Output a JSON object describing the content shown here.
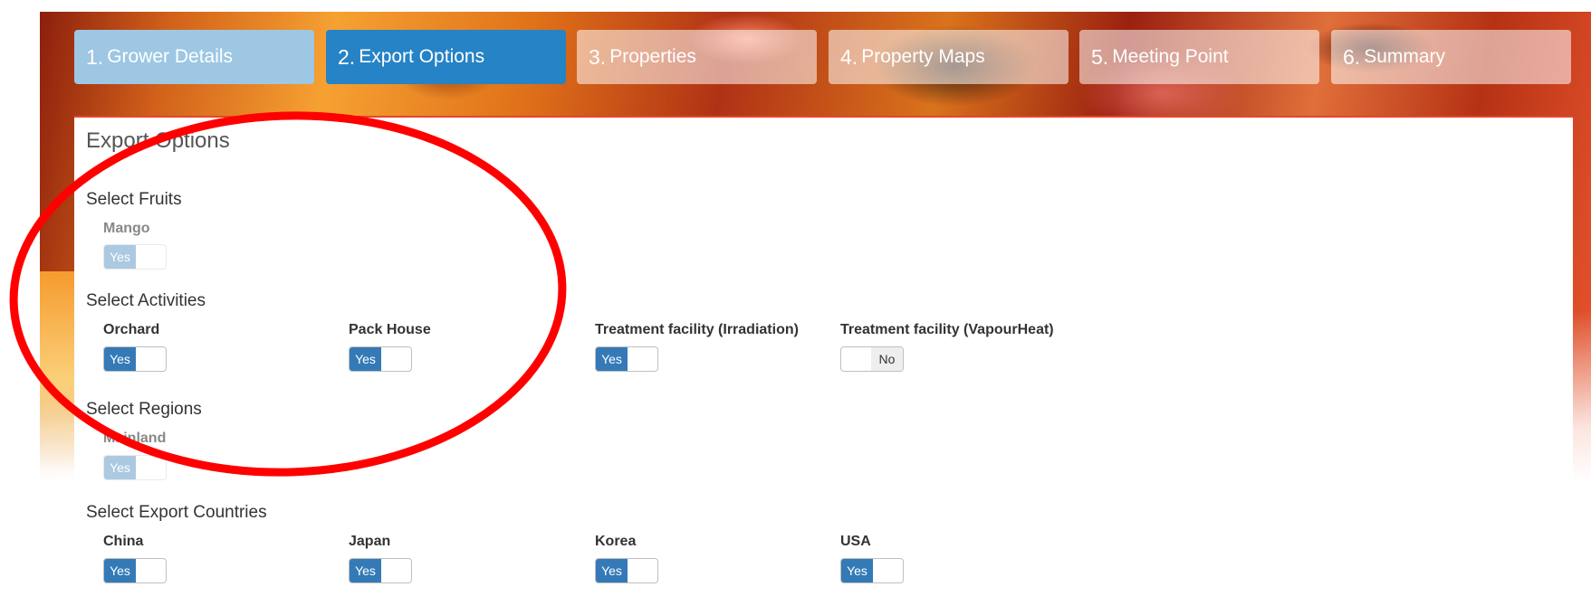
{
  "steps": [
    {
      "num": "1.",
      "label": "Grower Details",
      "state": "done"
    },
    {
      "num": "2.",
      "label": "Export Options",
      "state": "active"
    },
    {
      "num": "3.",
      "label": "Properties",
      "state": "pending"
    },
    {
      "num": "4.",
      "label": "Property Maps",
      "state": "pending"
    },
    {
      "num": "5.",
      "label": "Meeting Point",
      "state": "pending"
    },
    {
      "num": "6.",
      "label": "Summary",
      "state": "pending"
    }
  ],
  "panel": {
    "title": "Export Options",
    "fruits": {
      "label": "Select Fruits",
      "options": [
        {
          "name": "Mango",
          "value": "Yes",
          "disabled": true
        }
      ]
    },
    "activities": {
      "label": "Select Activities",
      "options": [
        {
          "name": "Orchard",
          "value": "Yes"
        },
        {
          "name": "Pack House",
          "value": "Yes"
        },
        {
          "name": "Treatment facility (Irradiation)",
          "value": "Yes"
        },
        {
          "name": "Treatment facility (VapourHeat)",
          "value": "No"
        }
      ]
    },
    "regions": {
      "label": "Select Regions",
      "options": [
        {
          "name": "Mainland",
          "value": "Yes",
          "disabled": true
        }
      ]
    },
    "countries": {
      "label": "Select Export Countries",
      "options": [
        {
          "name": "China",
          "value": "Yes"
        },
        {
          "name": "Japan",
          "value": "Yes"
        },
        {
          "name": "Korea",
          "value": "Yes"
        },
        {
          "name": "USA",
          "value": "Yes"
        }
      ]
    }
  },
  "colors": {
    "accent": "#2583c6",
    "toggle_on": "#337ab7",
    "annotation": "#ff0000",
    "panel_border": "#e8452a"
  }
}
